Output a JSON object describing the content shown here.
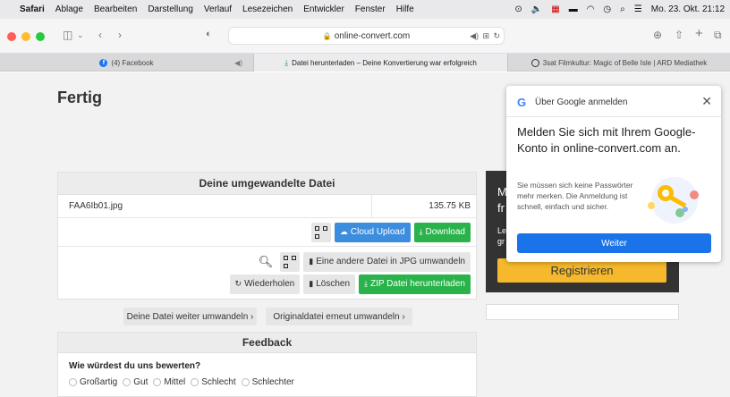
{
  "menubar": {
    "items": [
      "Safari",
      "Ablage",
      "Bearbeiten",
      "Darstellung",
      "Verlauf",
      "Lesezeichen",
      "Entwickler",
      "Fenster",
      "Hilfe"
    ],
    "clock": "Mo. 23. Okt. 21:12"
  },
  "toolbar": {
    "url": "online-convert.com"
  },
  "tabs": [
    {
      "label": "(4) Facebook"
    },
    {
      "label": "Datei herunterladen – Deine Konvertierung war erfolgreich"
    },
    {
      "label": "3sat Filmkultur: Magic of Belle Isle | ARD Mediathek"
    }
  ],
  "page": {
    "title": "Fertig",
    "panel": {
      "heading": "Deine umgewandelte Datei",
      "file_name": "FAA6Ib01.jpg",
      "file_size": "135.75 KB",
      "cloud_upload": "Cloud Upload",
      "download": "Download",
      "convert_other": "Eine andere Datei in JPG umwandeln",
      "retry": "Wiederholen",
      "delete": "Löschen",
      "zip": "ZIP Datei herunterladen"
    },
    "convert_further": "Deine Datei weiter umwandeln ›",
    "convert_original": "Originaldatei erneut umwandeln ›",
    "feedback": {
      "heading": "Feedback",
      "question": "Wie würdest du uns bewerten?",
      "options": [
        "Großartig",
        "Gut",
        "Mittel",
        "Schlecht",
        "Schlechter"
      ]
    },
    "promo": {
      "line1": "M",
      "line2": "fr",
      "small1": "Le",
      "small2": "gr",
      "register": "Registrieren"
    }
  },
  "google_popup": {
    "header": "Über Google anmelden",
    "title": "Melden Sie sich mit Ihrem Google-Konto in online-convert.com an.",
    "body": "Sie müssen sich keine Passwörter mehr merken. Die Anmeldung ist schnell, einfach und sicher.",
    "button": "Weiter"
  },
  "colors": {
    "blue_button": "#3c8dde",
    "green_button": "#29b34a",
    "register_button": "#f6b82d",
    "google_blue": "#1a73e8"
  }
}
